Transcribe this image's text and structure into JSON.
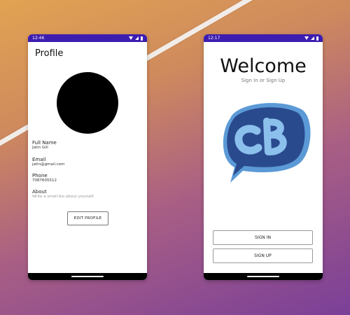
{
  "profile_screen": {
    "status_time": "12:46",
    "title": "Profile",
    "fields": [
      {
        "label": "Full Name",
        "value": "Jatin Gill"
      },
      {
        "label": "Email",
        "value": "jatin@gmail.com"
      },
      {
        "label": "Phone",
        "value": "7087605512"
      },
      {
        "label": "About",
        "value": "Write a small bio about yourself."
      }
    ],
    "edit_button": "EDIT PROFILE"
  },
  "welcome_screen": {
    "status_time": "12:17",
    "title": "Welcome",
    "subtitle": "Sign In or Sign Up",
    "logo_text": "CB",
    "sign_in_button": "SIGN IN",
    "sign_up_button": "SIGN UP"
  },
  "colors": {
    "status_bar": "#3d1db0",
    "logo_blue": "#2a4a8e",
    "logo_light": "#5b9ad6"
  }
}
